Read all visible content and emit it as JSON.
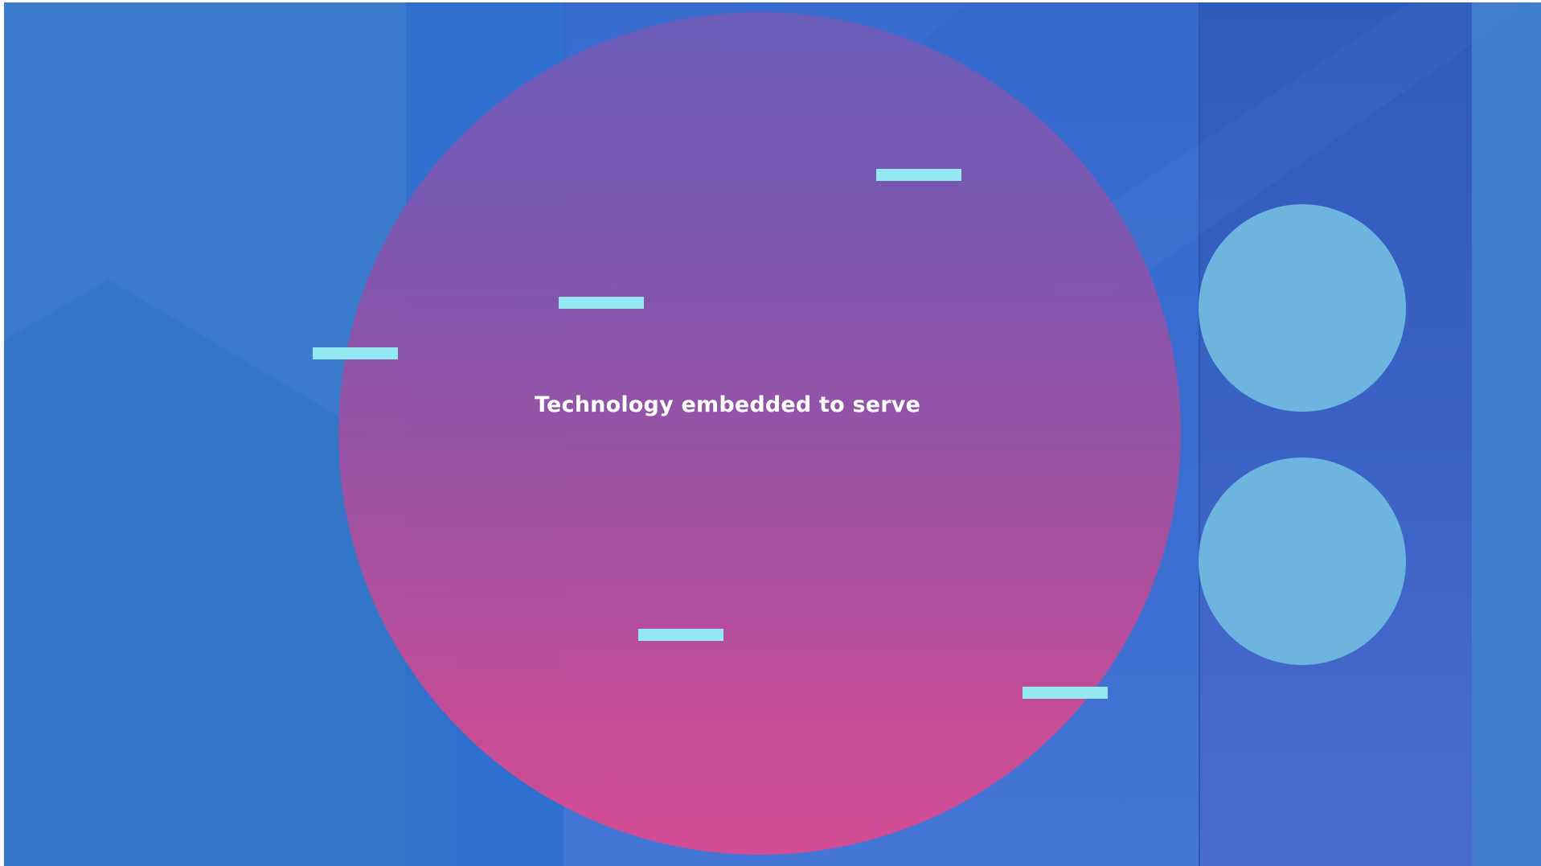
{
  "slide": {
    "headline": "Technology embedded to serve"
  },
  "colors": {
    "background": "#3a7ccd",
    "circle_top": "#6b5bb8",
    "circle_bottom": "#d84b92",
    "dash": "#93e8f2",
    "small_circle": "#6db4de",
    "text": "#ffffff"
  },
  "decorations": {
    "dash_count": 5,
    "small_circle_count": 2
  }
}
